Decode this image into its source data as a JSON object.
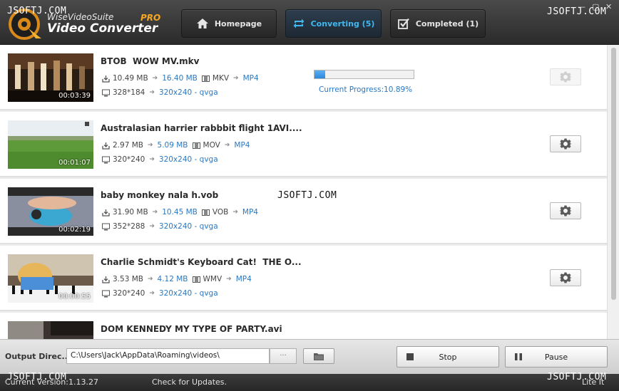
{
  "header": {
    "brand_small": "WiseVideoSuite",
    "brand_pro": "PRO",
    "brand_title": "Video Converter",
    "nav": [
      {
        "label": "Homepage",
        "icon": "home-icon"
      },
      {
        "label": "Converting (5)",
        "icon": "convert-arrows-icon",
        "active": true
      },
      {
        "label": "Completed (1)",
        "icon": "checkbox-icon"
      }
    ],
    "window_controls": {
      "minimize": "—",
      "restore": "▢",
      "close": "✕"
    }
  },
  "items": [
    {
      "title": "BTOB  WOW MV.mkv",
      "duration": "00:03:39",
      "size_in": "10.49 MB",
      "size_out": "16.40 MB",
      "format_in": "MKV",
      "format_out": "MP4",
      "res_in": "328*184",
      "res_out": "320x240 - qvga",
      "progress": 10.89,
      "progress_label": "Current Progress:10.89%",
      "status": "converting"
    },
    {
      "title": "Australasian harrier rabbbit flight 1AVI....",
      "duration": "00:01:07",
      "size_in": "2.97 MB",
      "size_out": "5.09 MB",
      "format_in": "MOV",
      "format_out": "MP4",
      "res_in": "320*240",
      "res_out": "320x240 - qvga"
    },
    {
      "title": "baby monkey nala h.vob",
      "duration": "00:02:19",
      "size_in": "31.90 MB",
      "size_out": "10.45 MB",
      "format_in": "VOB",
      "format_out": "MP4",
      "res_in": "352*288",
      "res_out": "320x240 - qvga"
    },
    {
      "title": "Charlie Schmidt's Keyboard Cat!  THE O...",
      "duration": "00:00:55",
      "size_in": "3.53 MB",
      "size_out": "4.12 MB",
      "format_in": "WMV",
      "format_out": "MP4",
      "res_in": "320*240",
      "res_out": "320x240 - qvga"
    },
    {
      "title": "DOM KENNEDY MY TYPE OF PARTY.avi"
    }
  ],
  "bottom": {
    "output_label": "Output Direc...",
    "output_path": "C:\\Users\\Jack\\AppData\\Roaming\\videos\\",
    "browse_label": "···",
    "stop_label": "Stop",
    "pause_label": "Pause"
  },
  "status": {
    "version": "Current Version:1.13.27",
    "updates": "Check for Updates.",
    "edition": "Lite It"
  },
  "watermark": "JSOFTJ.COM",
  "colors": {
    "accent": "#41b8f0",
    "link": "#2b78c2",
    "progress": "#2f88dc",
    "pro": "#f5a623"
  }
}
